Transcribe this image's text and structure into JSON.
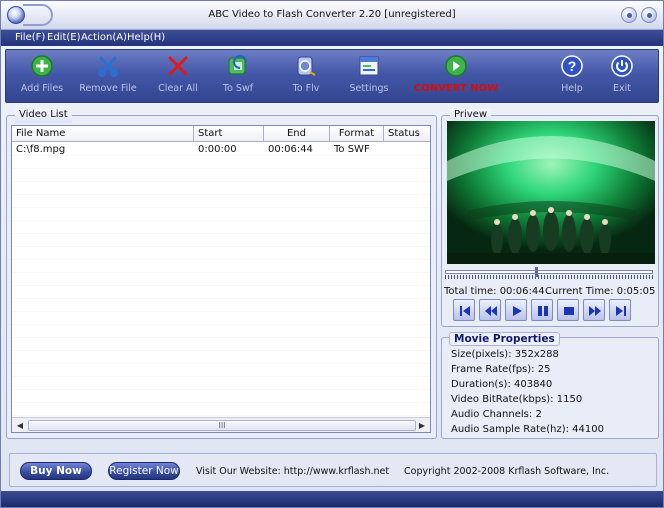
{
  "window": {
    "title": "ABC Video to Flash Converter 2.20 [unregistered]"
  },
  "menu": [
    "File(F)",
    "Edit(E)",
    "Action(A)",
    "Help(H)"
  ],
  "toolbar": {
    "add_files": "Add Files",
    "remove_file": "Remove File",
    "clear_all": "Clear All",
    "to_swf": "To Swf",
    "to_flv": "To Flv",
    "settings": "Settings",
    "convert_now": "CONVERT NOW",
    "help": "Help",
    "exit": "Exit"
  },
  "video_list": {
    "title": "Video List",
    "columns": [
      "File Name",
      "Start",
      "End",
      "Format",
      "Status"
    ],
    "rows": [
      {
        "file_name": "C:\\f8.mpg",
        "start": "0:00:00",
        "end": "00:06:44",
        "format": "To SWF",
        "status": ""
      }
    ],
    "scroll_grip": "III"
  },
  "preview": {
    "title": "Privew",
    "total_time_label": "Total time:",
    "total_time": "00:06:44",
    "current_time_label": "Current Time:",
    "current_time": "0:05:05",
    "seek_position": 0.44
  },
  "properties": {
    "title": "Movie Properties",
    "items": [
      {
        "label": "Size(pixels):",
        "value": "352x288"
      },
      {
        "label": "Frame Rate(fps):",
        "value": "25"
      },
      {
        "label": "Duration(s):",
        "value": "403840"
      },
      {
        "label": "Video BitRate(kbps):",
        "value": "1150"
      },
      {
        "label": "Audio Channels:",
        "value": "2"
      },
      {
        "label": "Audio Sample Rate(hz):",
        "value": "44100"
      }
    ]
  },
  "footer": {
    "buy_now": "Buy Now",
    "register_now": "Register Now",
    "website": "Visit Our Website: http://www.krflash.net",
    "copyright": "Copyright 2002-2008 Krflash Software, Inc."
  },
  "colors": {
    "accent": "#3a4ea3",
    "toolbar_bg": "#4458a8",
    "convert_text": "#d80c0c",
    "menubar_bg": "#24337a"
  }
}
